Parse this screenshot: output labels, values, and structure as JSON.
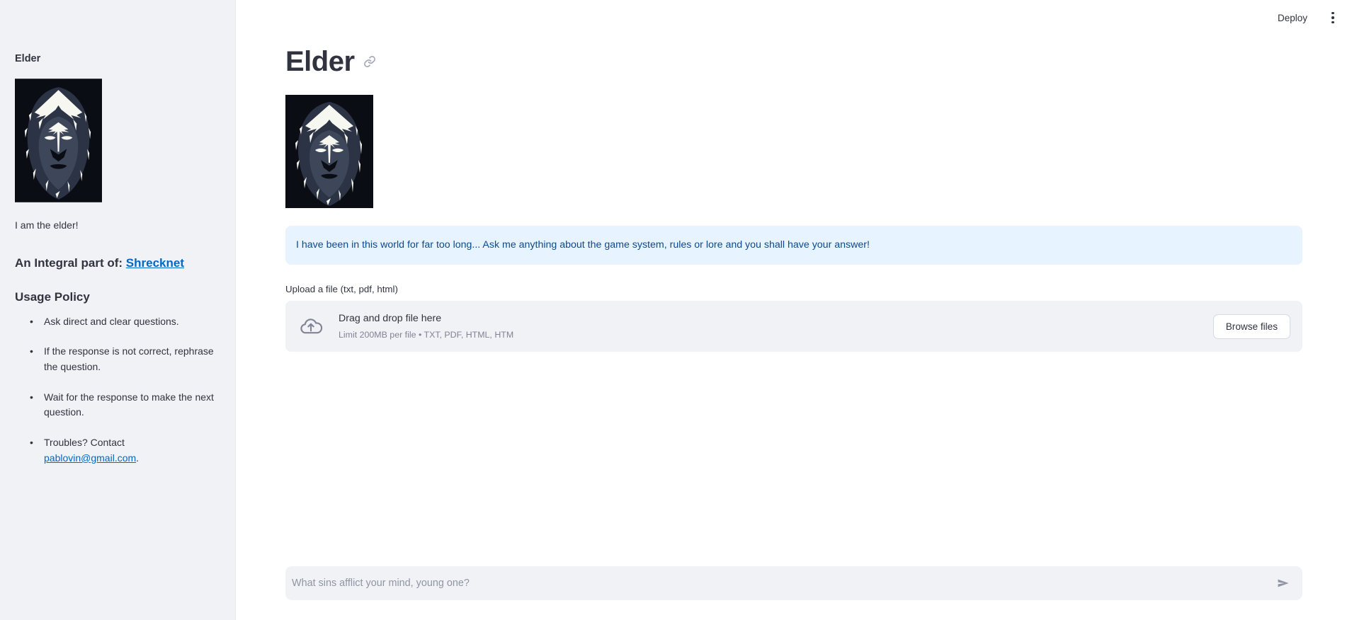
{
  "toolbar": {
    "deploy_label": "Deploy",
    "menu_icon": "kebab-menu-icon"
  },
  "sidebar": {
    "title": "Elder",
    "portrait_alt": "elder-hooded-figure",
    "caption": "I am the elder!",
    "integral_prefix": "An Integral part of: ",
    "integral_link": "Shrecknet",
    "policy_heading": "Usage Policy",
    "policy_items": [
      {
        "text": "Ask direct and clear questions."
      },
      {
        "text": "If the response is not correct, rephrase the question."
      },
      {
        "text": "Wait for the response to make the next question."
      },
      {
        "text_prefix": "Troubles? Contact ",
        "link": "pablovin@gmail.com",
        "text_suffix": "."
      }
    ]
  },
  "main": {
    "page_title": "Elder",
    "anchor_icon": "link-icon",
    "portrait_alt": "elder-hooded-figure",
    "info_banner": "I have been in this world for far too long... Ask me anything about the game system, rules or lore and you shall have your answer!",
    "uploader": {
      "label": "Upload a file (txt, pdf, html)",
      "icon": "cloud-upload-icon",
      "drop_title": "Drag and drop file here",
      "drop_sub": "Limit 200MB per file • TXT, PDF, HTML, HTM",
      "browse_label": "Browse files"
    },
    "chat": {
      "placeholder": "What sins afflict your mind, young one?",
      "value": "",
      "send_icon": "send-arrow-icon"
    }
  },
  "colors": {
    "sidebar_bg": "#f0f2f6",
    "info_bg": "#e7f3fe",
    "info_text": "#0c4a8f",
    "link": "#0068c9",
    "text": "#31333f",
    "muted": "#808495"
  }
}
